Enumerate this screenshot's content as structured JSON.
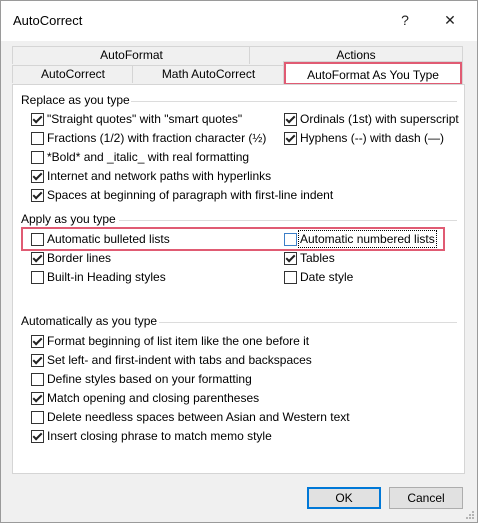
{
  "window": {
    "title": "AutoCorrect"
  },
  "titlebar": {
    "help_label": "?",
    "close_label": "✕"
  },
  "tabs_back": [
    {
      "label": "AutoFormat"
    },
    {
      "label": "Actions"
    }
  ],
  "tabs_front": [
    {
      "label": "AutoCorrect"
    },
    {
      "label": "Math AutoCorrect"
    },
    {
      "label": "AutoFormat As You Type",
      "selected": true
    }
  ],
  "replace_section": {
    "title": "Replace as you type",
    "left": [
      {
        "label": "\"Straight quotes\" with \"smart quotes\"",
        "checked": true
      },
      {
        "label": "Fractions (1/2) with fraction character (½)",
        "checked": false
      },
      {
        "label": "*Bold* and _italic_ with real formatting",
        "checked": false
      },
      {
        "label": "Internet and network paths with hyperlinks",
        "checked": true
      },
      {
        "label": "Spaces at beginning of paragraph with first-line indent",
        "checked": true
      }
    ],
    "right": [
      {
        "label": "Ordinals (1st) with superscript",
        "checked": true
      },
      {
        "label": "Hyphens (--) with dash (—)",
        "checked": true
      }
    ]
  },
  "apply_section": {
    "title": "Apply as you type",
    "left": [
      {
        "label": "Automatic bulleted lists",
        "checked": false
      },
      {
        "label": "Border lines",
        "checked": true
      },
      {
        "label": "Built-in Heading styles",
        "checked": false
      }
    ],
    "right": [
      {
        "label": "Automatic numbered lists",
        "checked": false
      },
      {
        "label": "Tables",
        "checked": true
      },
      {
        "label": "Date style",
        "checked": false
      }
    ]
  },
  "auto_section": {
    "title": "Automatically as you type",
    "items": [
      {
        "label": "Format beginning of list item like the one before it",
        "checked": true
      },
      {
        "label": "Set left- and first-indent with tabs and backspaces",
        "checked": true
      },
      {
        "label": "Define styles based on your formatting",
        "checked": false
      },
      {
        "label": "Match opening and closing parentheses",
        "checked": true
      },
      {
        "label": "Delete needless spaces between Asian and Western text",
        "checked": false
      },
      {
        "label": "Insert closing phrase to match memo style",
        "checked": true
      }
    ]
  },
  "buttons": {
    "ok_label": "OK",
    "cancel_label": "Cancel"
  },
  "colors": {
    "highlight": "#e05b73",
    "focus": "#3c7fc8",
    "default_button_border": "#0078d7"
  }
}
